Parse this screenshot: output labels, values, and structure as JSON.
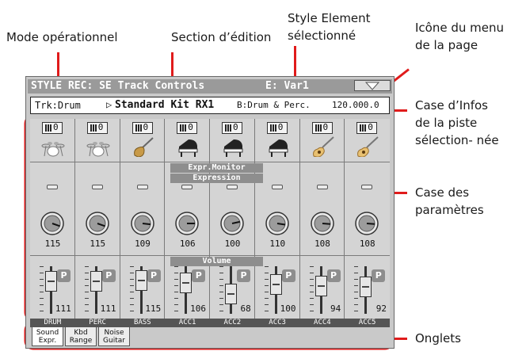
{
  "callouts": {
    "mode": "Mode opérationnel",
    "section": "Section d’édition",
    "style_element": "Style Element sélectionné",
    "page_menu": "Icône du menu de la page",
    "track_info": "Case d’Infos de la piste sélection- née",
    "params_box": "Case des paramètres",
    "tabs_label": "Onglets"
  },
  "header": {
    "title": "STYLE REC: SE Track Controls",
    "element": "E: Var1",
    "menu_icon": "triangle-down-icon"
  },
  "info": {
    "track": "Trk:Drum",
    "arrow": "▷",
    "sound": "Standard Kit RX1",
    "bank": "B:Drum & Perc.",
    "number": "120.000.0"
  },
  "sections": {
    "expr_monitor": "Expr.Monitor",
    "expression": "Expression",
    "volume": "Volume"
  },
  "tracks": [
    {
      "name": "DRUM",
      "mute": "0",
      "instrument": "drum-kit-icon",
      "expression": 115,
      "volume": 111
    },
    {
      "name": "PERC",
      "mute": "0",
      "instrument": "drum-kit-icon",
      "expression": 115,
      "volume": 111
    },
    {
      "name": "BASS",
      "mute": "0",
      "instrument": "electric-guitar-icon",
      "expression": 109,
      "volume": 115
    },
    {
      "name": "ACC1",
      "mute": "0",
      "instrument": "piano-icon",
      "expression": 106,
      "volume": 106
    },
    {
      "name": "ACC2",
      "mute": "0",
      "instrument": "piano-icon",
      "expression": 100,
      "volume": 68
    },
    {
      "name": "ACC3",
      "mute": "0",
      "instrument": "piano-icon",
      "expression": 110,
      "volume": 100
    },
    {
      "name": "ACC4",
      "mute": "0",
      "instrument": "acoustic-guitar-icon",
      "expression": 108,
      "volume": 94
    },
    {
      "name": "ACC5",
      "mute": "0",
      "instrument": "acoustic-guitar-icon",
      "expression": 108,
      "volume": 92
    }
  ],
  "pan_button": "P",
  "tabs": [
    {
      "label": "Sound Expr.",
      "active": true
    },
    {
      "label": "Kbd Range",
      "active": false
    },
    {
      "label": "Noise Guitar",
      "active": false
    }
  ],
  "colors": {
    "accent_red": "#e01b1b",
    "header_gray": "#9a9a9a",
    "panel": "#d4d4d4"
  }
}
